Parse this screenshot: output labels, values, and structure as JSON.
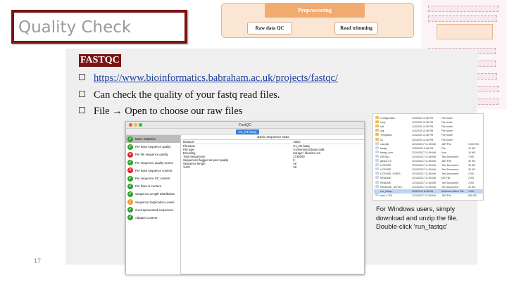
{
  "slide": {
    "title": "Quality Check",
    "page_number": "17"
  },
  "flow": {
    "header": "Preprocessing",
    "boxes": [
      "Raw data QC",
      "Read trimming"
    ]
  },
  "section": {
    "heading": "FASTQC",
    "bullets": [
      "https://www.bioinformatics.babraham.ac.uk/projects/fastqc/",
      "Can check the quality of your fastq read files.",
      "File → Open to choose our raw files"
    ]
  },
  "fastqc": {
    "window_title": "FastQC",
    "tab": "C1_R1.fastq",
    "main_title": "Basic sequence stats",
    "modules": [
      {
        "label": "Basic Statistics",
        "status": "pass",
        "selected": true
      },
      {
        "label": "Per base sequence quality",
        "status": "pass"
      },
      {
        "label": "Per tile sequence quality",
        "status": "fail"
      },
      {
        "label": "Per sequence quality scores",
        "status": "pass"
      },
      {
        "label": "Per base sequence content",
        "status": "fail"
      },
      {
        "label": "Per sequence GC content",
        "status": "pass"
      },
      {
        "label": "Per base N content",
        "status": "pass"
      },
      {
        "label": "Sequence Length Distribution",
        "status": "pass"
      },
      {
        "label": "Sequence Duplication Levels",
        "status": "warn"
      },
      {
        "label": "Overrepresented sequences",
        "status": "pass"
      },
      {
        "label": "Adapter Content",
        "status": "pass"
      }
    ],
    "table": {
      "headers": [
        "Measure",
        "Value"
      ],
      "rows": [
        [
          "Filename",
          "C1_R1.fastq"
        ],
        [
          "File type",
          "Conventional base calls"
        ],
        [
          "Encoding",
          "Sanger / Illumina 1.9"
        ],
        [
          "Total Sequences",
          "2745000"
        ],
        [
          "Sequences flagged as poor quality",
          "0"
        ],
        [
          "Sequence length",
          "48"
        ],
        [
          "%GC",
          "48"
        ]
      ]
    }
  },
  "files": [
    {
      "name": "Configuration",
      "date": "1/2/2020 11:38 PM",
      "type": "File folder",
      "size": ""
    },
    {
      "name": "Help",
      "date": "1/2/2020 11:38 PM",
      "type": "File folder",
      "size": ""
    },
    {
      "name": "net",
      "date": "1/2/2020 11:38 PM",
      "type": "File folder",
      "size": ""
    },
    {
      "name": "org",
      "date": "1/2/2020 11:38 PM",
      "type": "File folder",
      "size": ""
    },
    {
      "name": "Templates",
      "date": "1/2/2020 11:38 PM",
      "type": "File folder",
      "size": ""
    },
    {
      "name": "uk",
      "date": "1/2/2020 11:38 PM",
      "type": "File folder",
      "size": ""
    },
    {
      "name": "cisd-jdk",
      "date": "12/15/2017 11:59 AM",
      "type": "JAR File",
      "size": "3,020 KB"
    },
    {
      "name": "fastqc",
      "date": "1/30/2020 2:56 PM",
      "type": "File",
      "size": "15 KB"
    },
    {
      "name": "fastqc_icon",
      "date": "12/15/2017 11:59 AM",
      "type": "Icon",
      "size": "18 KB"
    },
    {
      "name": "INSTALL",
      "date": "12/15/2017 11:59 AM",
      "type": "Text Document",
      "size": "7 KB"
    },
    {
      "name": "jbzip2-0.9",
      "date": "12/15/2017 11:59 AM",
      "type": "JAR File",
      "size": "42 KB"
    },
    {
      "name": "LICENSE",
      "date": "12/15/2017 11:59 AM",
      "type": "Text Document",
      "size": "34 KB"
    },
    {
      "name": "LICENSE",
      "date": "12/15/2017 11:59 AM",
      "type": "Text Document",
      "size": "35 KB"
    },
    {
      "name": "LICENSE_JHDF5",
      "date": "12/15/2017 11:59 AM",
      "type": "Text Document",
      "size": "2 KB"
    },
    {
      "name": "README",
      "date": "12/15/2017 11:59 AM",
      "type": "MD File",
      "size": "2 KB"
    },
    {
      "name": "README",
      "date": "12/15/2017 11:59 AM",
      "type": "Text Document",
      "size": "2 KB"
    },
    {
      "name": "RELEASE_NOTES",
      "date": "12/15/2017 11:59 AM",
      "type": "Text Document",
      "size": "24 KB"
    },
    {
      "name": "run_fastqc",
      "date": "4/25/2019 8:46 AM",
      "type": "Windows Batch File",
      "size": "1 KB",
      "highlight": true
    },
    {
      "name": "sam-1.103",
      "date": "12/15/2017 11:59 AM",
      "type": "JAR File",
      "size": "690 KB"
    }
  ],
  "note": {
    "lines": [
      "For Windows users, simply",
      "download and unzip the file.",
      "Double-click ‘run_fastqc’"
    ]
  },
  "colors": {
    "accent": "#7a1414",
    "link": "#1b3d9f",
    "flow_header": "#f1ab6f"
  }
}
